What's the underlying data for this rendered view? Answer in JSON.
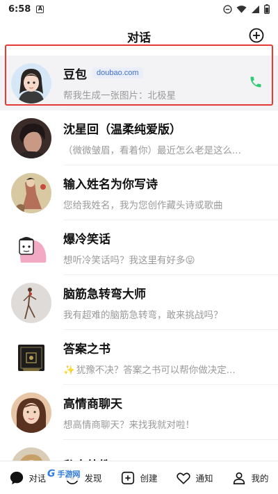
{
  "status_bar": {
    "time": "6:58",
    "notif_glyph": "A"
  },
  "header": {
    "title": "对话"
  },
  "chats": [
    {
      "name": "豆包",
      "badge": "doubao.com",
      "preview": "帮我生成一张图片：北极星",
      "avatar": "doubao-avatar"
    },
    {
      "name": "沈星回（温柔纯爱版）",
      "preview": "（微微皱眉，看着你）最近怎么老是这么...",
      "avatar": "man-portrait-avatar"
    },
    {
      "name": "输入姓名为你写诗",
      "preview": "您给我姓名，我为您创作藏头诗或歌曲",
      "avatar": "painting-avatar"
    },
    {
      "name": "爆冷笑话",
      "preview": "想听冷笑话吗？我这里有好多😝",
      "avatar": "cartoon-avatar"
    },
    {
      "name": "脑筋急转弯大师",
      "preview": "我有超难的脑筋急转弯，敢来挑战吗？",
      "avatar": "figurine-avatar"
    },
    {
      "name": "答案之书",
      "preview": "犹豫不决？答案之书可以帮你做决定...",
      "avatar": "book-avatar",
      "sparkle": "✨"
    },
    {
      "name": "高情商聊天",
      "preview": "想高情商聊天？来找我就对啦！",
      "avatar": "woman-portrait-avatar"
    },
    {
      "name": "私人外教",
      "preview": "",
      "avatar": "tutor-avatar"
    }
  ],
  "tabs": [
    {
      "label": "对话",
      "icon": "chat-bubble-icon"
    },
    {
      "label": "发现",
      "icon": "discover-icon"
    },
    {
      "label": "创建",
      "icon": "create-plus-icon"
    },
    {
      "label": "通知",
      "icon": "heart-icon"
    },
    {
      "label": "我的",
      "icon": "profile-icon"
    }
  ],
  "watermark": {
    "g": "G",
    "text": "手游网"
  },
  "colors": {
    "phone_green": "#2ecc71",
    "highlight_red": "#e53935",
    "badge_blue": "#3d6fcf"
  }
}
